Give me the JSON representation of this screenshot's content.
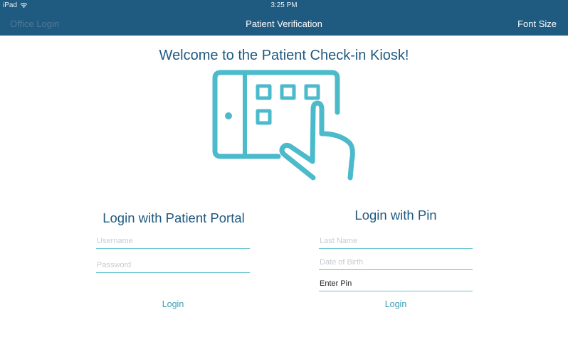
{
  "status_bar": {
    "device": "iPad",
    "time": "3:25 PM"
  },
  "nav": {
    "left_label": "Office Login",
    "title": "Patient Verification",
    "right_label": "Font Size"
  },
  "welcome_text": "Welcome to the Patient Check-in Kiosk!",
  "hero_icon": "tablet-touch-icon",
  "colors": {
    "header_bg": "#1f5a80",
    "accent": "#4bbacb",
    "title": "#1f5a80"
  },
  "portal_login": {
    "title": "Login with Patient Portal",
    "username_placeholder": "Username",
    "password_placeholder": "Password",
    "button_label": "Login"
  },
  "pin_login": {
    "title": "Login with Pin",
    "last_name_placeholder": "Last Name",
    "dob_placeholder": "Date of Birth",
    "pin_value": "Enter Pin",
    "button_label": "Login"
  }
}
